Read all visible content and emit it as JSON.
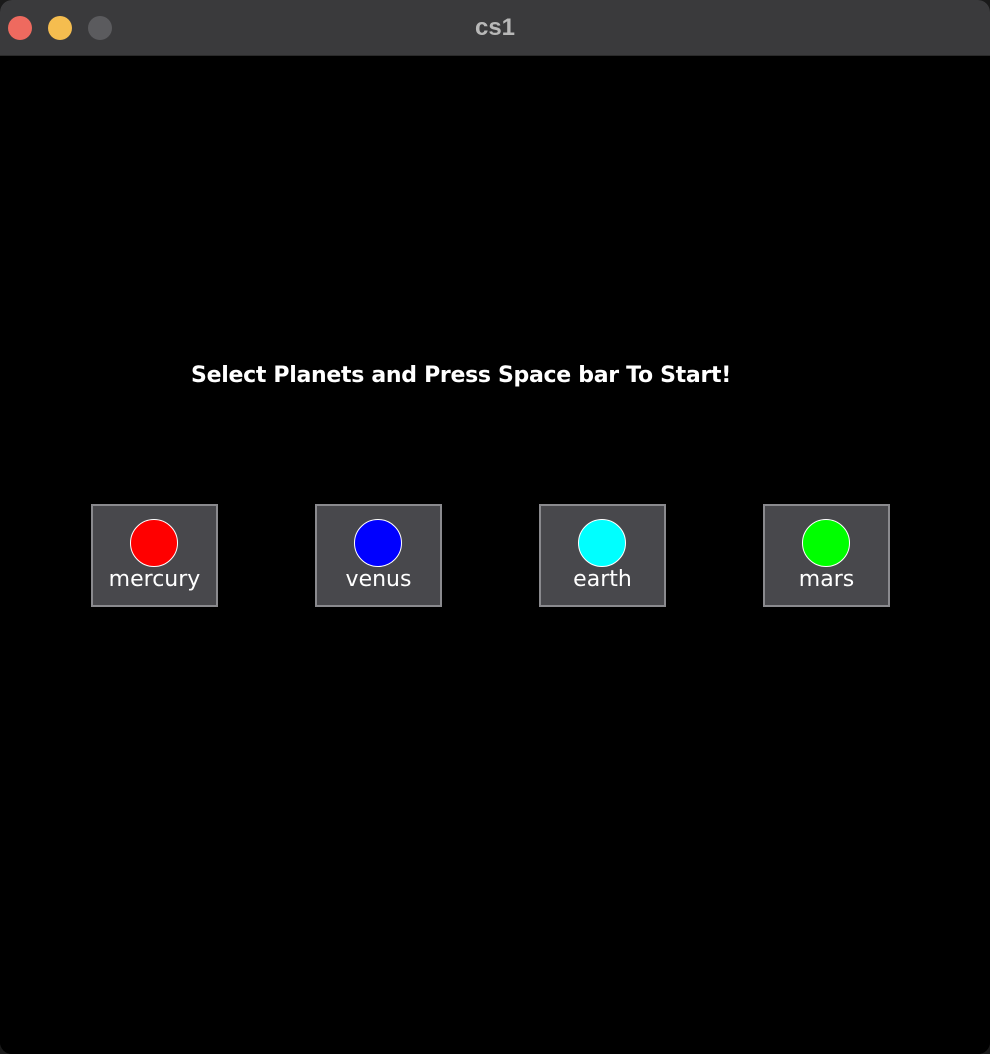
{
  "window": {
    "title": "cs1",
    "controls": {
      "close_color": "#ee6a5f",
      "minimize_color": "#f5bd4f",
      "zoom_color": "#5b5b5e"
    }
  },
  "instruction": "Select Planets and Press Space bar To Start!",
  "planets": [
    {
      "label": "mercury",
      "color": "#ff0000"
    },
    {
      "label": "venus",
      "color": "#0000ff"
    },
    {
      "label": "earth",
      "color": "#00ffff"
    },
    {
      "label": "mars",
      "color": "#00ff00"
    }
  ]
}
